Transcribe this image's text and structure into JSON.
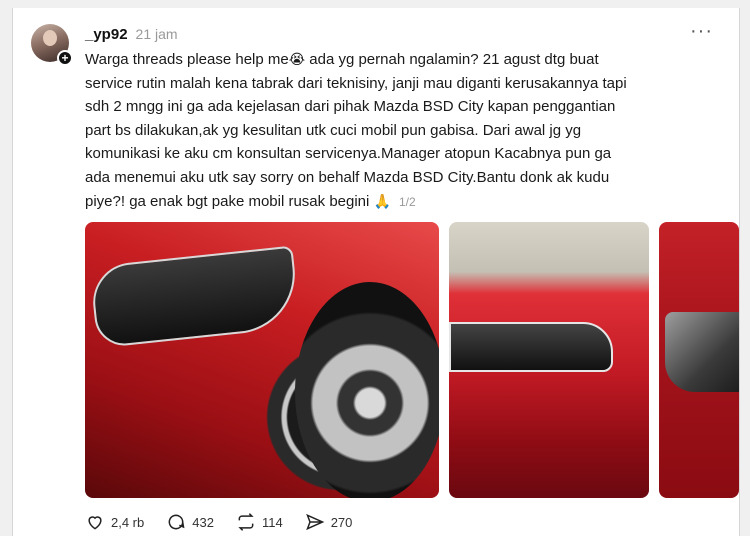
{
  "post": {
    "username": "_yp92",
    "time": "21 jam",
    "more_icon": "more-horizontal-icon",
    "text_before_emoji": "Warga threads please help me",
    "emoji": "😭",
    "text_after_emoji": " ada yg pernah ngalamin? 21 agust dtg buat\nservice rutin malah kena tabrak dari teknisiny, janji mau diganti kerusakannya tapi\nsdh 2 mngg ini ga ada kejelasan dari pihak Mazda BSD City kapan penggantian\npart bs dilakukan,ak yg kesulitan utk cuci mobil pun gabisa. Dari awal jg yg\nkomunikasi ke aku cm konsultan servicenya.Manager atopun Kacabnya pun ga\nada menemui aku utk say sorry on behalf Mazda BSD City.Bantu donk ak kudu\npiye?! ga enak bgt pake mobil rusak begini ",
    "end_emoji": "🙏",
    "image_counter": "1/2"
  },
  "actions": {
    "likes": "2,4 rb",
    "comments": "432",
    "reposts": "114",
    "shares": "270"
  },
  "colors": {
    "accent": "#111111",
    "muted": "#999999",
    "car_red": "#c81e22"
  }
}
